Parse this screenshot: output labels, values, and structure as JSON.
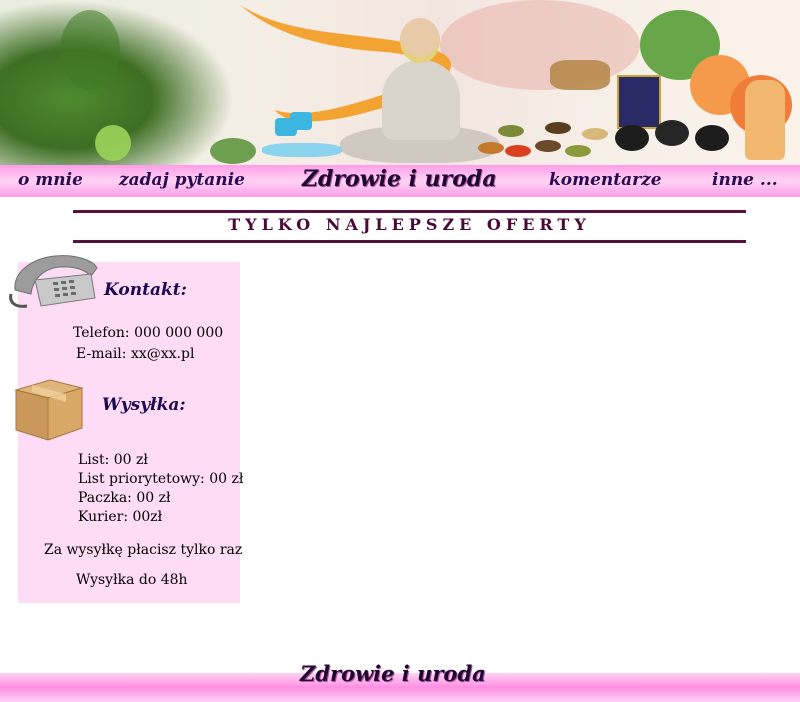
{
  "nav": {
    "items": [
      "o mnie",
      "zadaj pytanie",
      "komentarze",
      "inne ..."
    ],
    "site_title": "Zdrowie i uroda"
  },
  "heading": "TYLKO NAJLEPSZE OFERTY",
  "sidebar": {
    "contact": {
      "title": "Kontakt:",
      "phone": "Telefon: 000 000 000",
      "email": "E-mail: xx@xx.pl"
    },
    "shipping": {
      "title": "Wysyłka:",
      "items": [
        "List: 00 zł",
        "List priorytetowy: 00 zł",
        "Paczka: 00 zł",
        "Kurier: 00zł"
      ],
      "note": "Za wysyłkę płacisz tylko raz",
      "delivery": "Wysyłka do 48h"
    }
  },
  "footer": {
    "title": "Zdrowie i uroda"
  },
  "colors": {
    "nav_pink": "#ff9de8",
    "sidebar_bg": "#ffdcf6",
    "heading": "#4a0a37",
    "nav_text": "#2a0852"
  },
  "icons": {
    "contact": "telephone-icon",
    "shipping": "cardboard-box-icon"
  }
}
